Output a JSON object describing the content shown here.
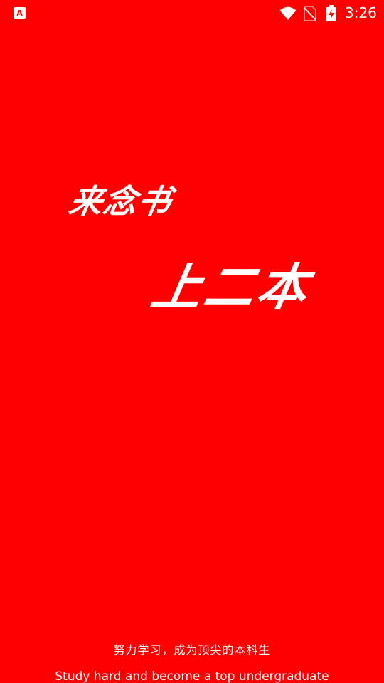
{
  "status_bar": {
    "notification_icon": "app-notification-icon",
    "notification_glyph": "A",
    "icons": [
      "wifi-icon",
      "no-sim-icon",
      "battery-charging-icon"
    ],
    "time": "3:26"
  },
  "splash": {
    "slogan_line1": "来念书",
    "slogan_line2": "上二本",
    "tagline_cn": "努力学习，成为顶尖的本科生",
    "tagline_en": "Study hard and become a top undergraduate"
  },
  "colors": {
    "background": "#ff0000",
    "text": "#ffffff"
  }
}
